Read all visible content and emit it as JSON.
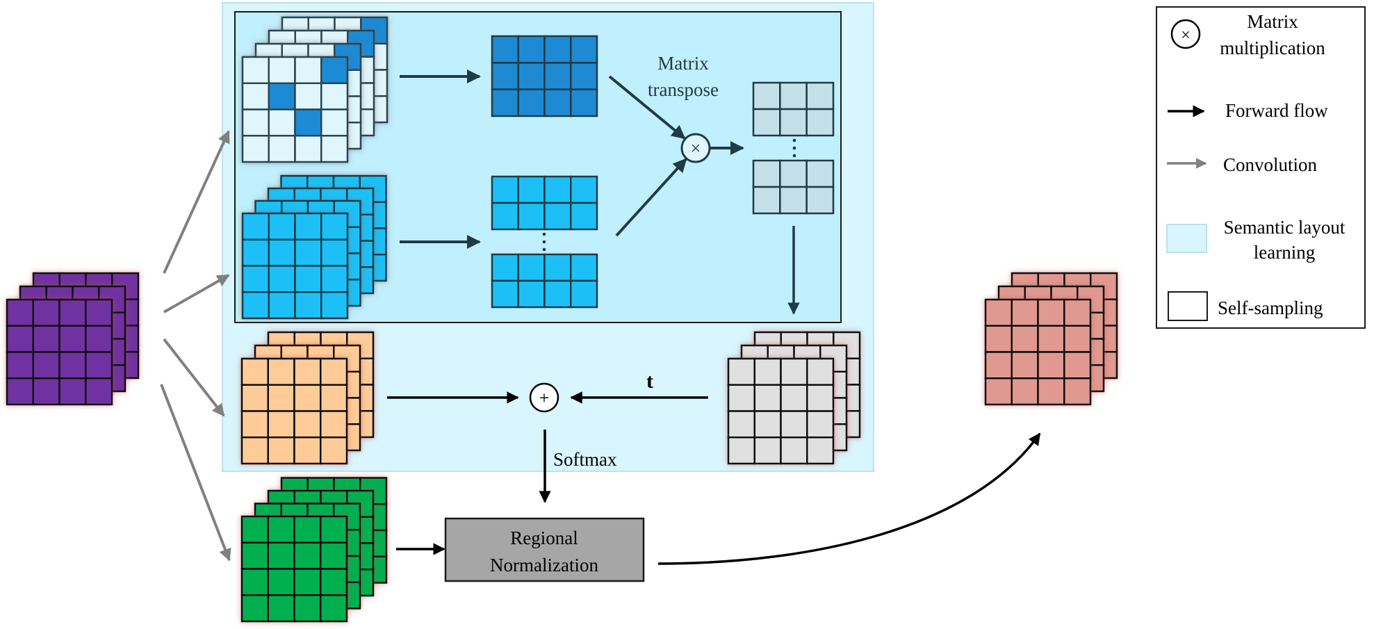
{
  "diagram": {
    "type": "neural-network-module-flow",
    "input": {
      "name": "input-feature-map",
      "layers": 3,
      "grid": [
        4,
        4
      ],
      "color": "#7030a0"
    },
    "branches": [
      {
        "name": "attention-map-branch",
        "layers": 4,
        "grid": [
          4,
          4
        ],
        "color": "#dff6fc",
        "highlight_color": "#1e8ad4",
        "highlighted_cells_front": [
          [
            0,
            3
          ],
          [
            1,
            1
          ],
          [
            2,
            2
          ]
        ],
        "highlighted_cell_back_layers": [
          0,
          3
        ]
      },
      {
        "name": "key-branch",
        "layers": 4,
        "grid": [
          4,
          4
        ],
        "color": "#1cc0f7"
      },
      {
        "name": "value-branch",
        "layers": 3,
        "grid": [
          4,
          4
        ],
        "color": "#ffcc99"
      },
      {
        "name": "norm-input-branch",
        "layers": 4,
        "grid": [
          4,
          4
        ],
        "color": "#00b050"
      }
    ],
    "reshaped": {
      "attention": {
        "grid": [
          3,
          4
        ],
        "color": "#1e8ad4"
      },
      "key": {
        "grid": [
          2,
          4
        ],
        "count_shown": 2,
        "ellipsis": "⋮",
        "color": "#1cc0f7"
      },
      "product": {
        "grid": [
          2,
          3
        ],
        "count_shown": 2,
        "ellipsis": "⋮",
        "color": "#c5e0e8"
      }
    },
    "restored": {
      "layers": 3,
      "grid": [
        4,
        4
      ],
      "color": "#e0e0e0"
    },
    "output": {
      "layers": 3,
      "grid": [
        4,
        4
      ],
      "color": "#e09990"
    },
    "labels": {
      "matrix_transpose_line1": "Matrix",
      "matrix_transpose_line2": "transpose",
      "t": "t",
      "softmax": "Softmax",
      "regional_norm_line1": "Regional",
      "regional_norm_line2": "Normalization"
    },
    "operators": {
      "multiply": "×",
      "add": "+"
    },
    "regions": {
      "semantic_layout_learning_color": "#d9f5fd",
      "self_sampling_color": "#c0effd",
      "regional_norm_color": "#a6a6a6"
    }
  },
  "legend": {
    "items": [
      {
        "icon": "multiply-circle-icon",
        "symbol": "×",
        "line1": "Matrix",
        "line2": "multiplication"
      },
      {
        "icon": "black-arrow-icon",
        "label": "Forward flow"
      },
      {
        "icon": "gray-arrow-icon",
        "label": "Convolution"
      },
      {
        "icon": "light-blue-swatch-icon",
        "line1": "Semantic layout",
        "line2": "learning"
      },
      {
        "icon": "white-box-icon",
        "label": "Self-sampling"
      }
    ]
  }
}
